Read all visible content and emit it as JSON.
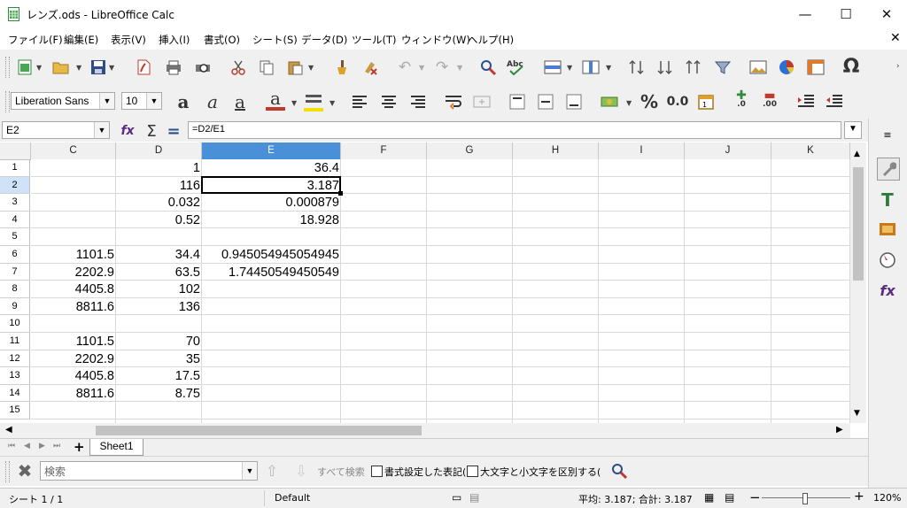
{
  "window": {
    "title": "レンズ.ods - LibreOffice Calc",
    "minimize": "—",
    "maximize": "☐",
    "close": "✕",
    "doc_close": "✕"
  },
  "menu": [
    "ファイル(F)",
    "編集(E)",
    "表示(V)",
    "挿入(I)",
    "書式(O)",
    "シート(S)",
    "データ(D)",
    "ツール(T)",
    "ウィンドウ(W)",
    "ヘルプ(H)"
  ],
  "format_toolbar": {
    "font_name": "Liberation Sans",
    "font_size": "10",
    "percent": "%",
    "decimal": "0.0",
    "add_decimal": ".0",
    "del_decimal": ".00"
  },
  "formula_bar": {
    "name_box": "E2",
    "formula": "=D2/E1"
  },
  "columns": [
    "C",
    "D",
    "E",
    "F",
    "G",
    "H",
    "I",
    "J",
    "K"
  ],
  "selected_column": "E",
  "rows": [
    "1",
    "2",
    "3",
    "4",
    "5",
    "6",
    "7",
    "8",
    "9",
    "10",
    "11",
    "12",
    "13",
    "14",
    "15"
  ],
  "selected_row": "2",
  "cells": [
    {
      "row": 1,
      "col": "D",
      "value": "1"
    },
    {
      "row": 1,
      "col": "E",
      "value": "36.4"
    },
    {
      "row": 2,
      "col": "D",
      "value": "116"
    },
    {
      "row": 2,
      "col": "E",
      "value": "3.187"
    },
    {
      "row": 3,
      "col": "D",
      "value": "0.032"
    },
    {
      "row": 3,
      "col": "E",
      "value": "0.000879"
    },
    {
      "row": 4,
      "col": "D",
      "value": "0.52"
    },
    {
      "row": 4,
      "col": "E",
      "value": "18.928"
    },
    {
      "row": 6,
      "col": "C",
      "value": "1101.5"
    },
    {
      "row": 6,
      "col": "D",
      "value": "34.4"
    },
    {
      "row": 6,
      "col": "E",
      "value": "0.945054945054945"
    },
    {
      "row": 7,
      "col": "C",
      "value": "2202.9"
    },
    {
      "row": 7,
      "col": "D",
      "value": "63.5"
    },
    {
      "row": 7,
      "col": "E",
      "value": "1.74450549450549"
    },
    {
      "row": 8,
      "col": "C",
      "value": "4405.8"
    },
    {
      "row": 8,
      "col": "D",
      "value": "102"
    },
    {
      "row": 9,
      "col": "C",
      "value": "8811.6"
    },
    {
      "row": 9,
      "col": "D",
      "value": "136"
    },
    {
      "row": 11,
      "col": "C",
      "value": "1101.5"
    },
    {
      "row": 11,
      "col": "D",
      "value": "70"
    },
    {
      "row": 12,
      "col": "C",
      "value": "2202.9"
    },
    {
      "row": 12,
      "col": "D",
      "value": "35"
    },
    {
      "row": 13,
      "col": "C",
      "value": "4405.8"
    },
    {
      "row": 13,
      "col": "D",
      "value": "17.5"
    },
    {
      "row": 14,
      "col": "C",
      "value": "8811.6"
    },
    {
      "row": 14,
      "col": "D",
      "value": "8.75"
    }
  ],
  "sheet_tabs": {
    "add": "+",
    "active": "Sheet1"
  },
  "find_bar": {
    "placeholder": "検索",
    "find_all": "すべて検索",
    "formatted_display": "書式設定した表記(",
    "match_case": "大文字と小文字を区別する("
  },
  "status_bar": {
    "sheet": "シート 1 / 1",
    "page_style": "Default",
    "summary": "平均: 3.187; 合計: 3.187",
    "zoom": "120%",
    "zoom_out": "−",
    "zoom_in": "+"
  },
  "colors": {
    "selected_header": "#4a90d9",
    "selected_row_header": "#cfe2f7",
    "accent_red": "#c0392b"
  }
}
